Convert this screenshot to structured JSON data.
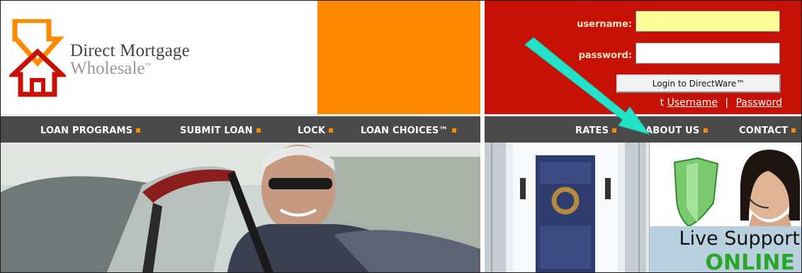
{
  "brand": {
    "name_line1": "Direct Mortgage",
    "name_line2": "Wholesale",
    "trademark": "™",
    "logo_icon": "house-arrow-logo-icon",
    "colors": {
      "orange": "#ff8a00",
      "red": "#c71106",
      "nav": "#4a4a4a"
    }
  },
  "login": {
    "username_label": "username:",
    "password_label": "password:",
    "username_value": "",
    "password_value": "",
    "button_label": "Login to DirectWare™",
    "forgot_prefix": "t",
    "forgot_username": "Username",
    "forgot_separator": "|",
    "forgot_password": "Password"
  },
  "nav_left": [
    {
      "label": "LOAN PROGRAMS"
    },
    {
      "label": "SUBMIT LOAN"
    },
    {
      "label": "LOCK"
    },
    {
      "label": "LOAN CHOICES™"
    }
  ],
  "nav_right": [
    {
      "label": "RATES"
    },
    {
      "label": "ABOUT US"
    },
    {
      "label": "CONTACT"
    }
  ],
  "support_banner": {
    "line1": "Live Support",
    "line2": "ONLINE",
    "shield_icon": "shield-icon",
    "accent": "#2aa62a"
  },
  "annotation": {
    "arrow_icon": "cyan-arrow-icon",
    "color": "#22e3c8"
  }
}
